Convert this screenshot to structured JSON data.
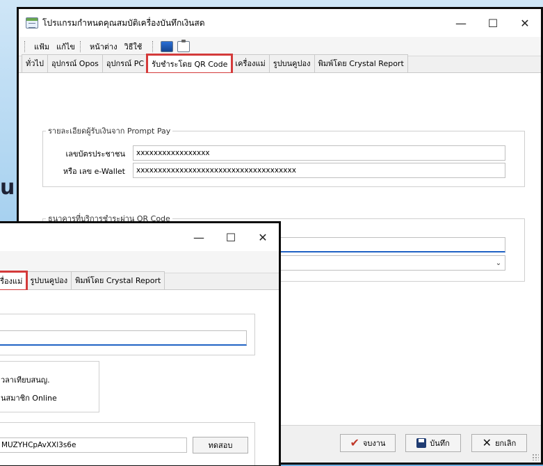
{
  "backdrop": {
    "heading": "u Online"
  },
  "main_window": {
    "title": "โปรแกรมกำหนดคุณสมบัติเครื่องบันทึกเงินสด",
    "controls": {
      "minimize": "—",
      "maximize": "☐",
      "close": "✕"
    },
    "menu": [
      "แฟ้ม",
      "แก้ไข",
      "หน้าต่าง",
      "วิธีใช้"
    ],
    "tabs": [
      {
        "label": "ทั่วไป"
      },
      {
        "label": "อุปกรณ์ Opos"
      },
      {
        "label": "อุปกรณ์ PC"
      },
      {
        "label": "รับชำระโดย QR Code"
      },
      {
        "label": "เครื่องแม่"
      },
      {
        "label": "รูปบนคูปอง"
      },
      {
        "label": "พิมพ์โดย Crystal Report"
      }
    ],
    "active_tab": "รับชำระโดย QR Code",
    "prompt_pay": {
      "legend": "รายละเอียดผู้รับเงินจาก Prompt Pay",
      "id_label": "เลขบัตรประชาชน",
      "id_value": "xxxxxxxxxxxxxxxxx",
      "ewallet_label": "หรือ เลข e-Wallet",
      "ewallet_value": "xxxxxxxxxxxxxxxxxxxxxxxxxxxxxxxxxxxxx"
    },
    "bank": {
      "legend": "ธนาคารที่บริการชำระผ่าน QR Code",
      "field_value": "",
      "combo_value": ""
    },
    "buttons": {
      "ok": "จบงาน",
      "save": "บันทึก",
      "cancel": "ยกเลิก"
    },
    "accent": {
      "highlight": "#d43a3a",
      "focus": "#1f62c4"
    }
  },
  "back_window": {
    "controls": {
      "minimize": "—",
      "maximize": "☐",
      "close": "✕"
    },
    "tabs": [
      {
        "label": "เครื่องแม่"
      },
      {
        "label": "รูปบนคูปอง"
      },
      {
        "label": "พิมพ์โดย Crystal Report"
      }
    ],
    "options": [
      "วลาเทียบสนญ.",
      "นสมาชิก Online"
    ],
    "api_key": "MUZYHCpAvXXl3s6e",
    "test_button": "ทดสอบ"
  }
}
